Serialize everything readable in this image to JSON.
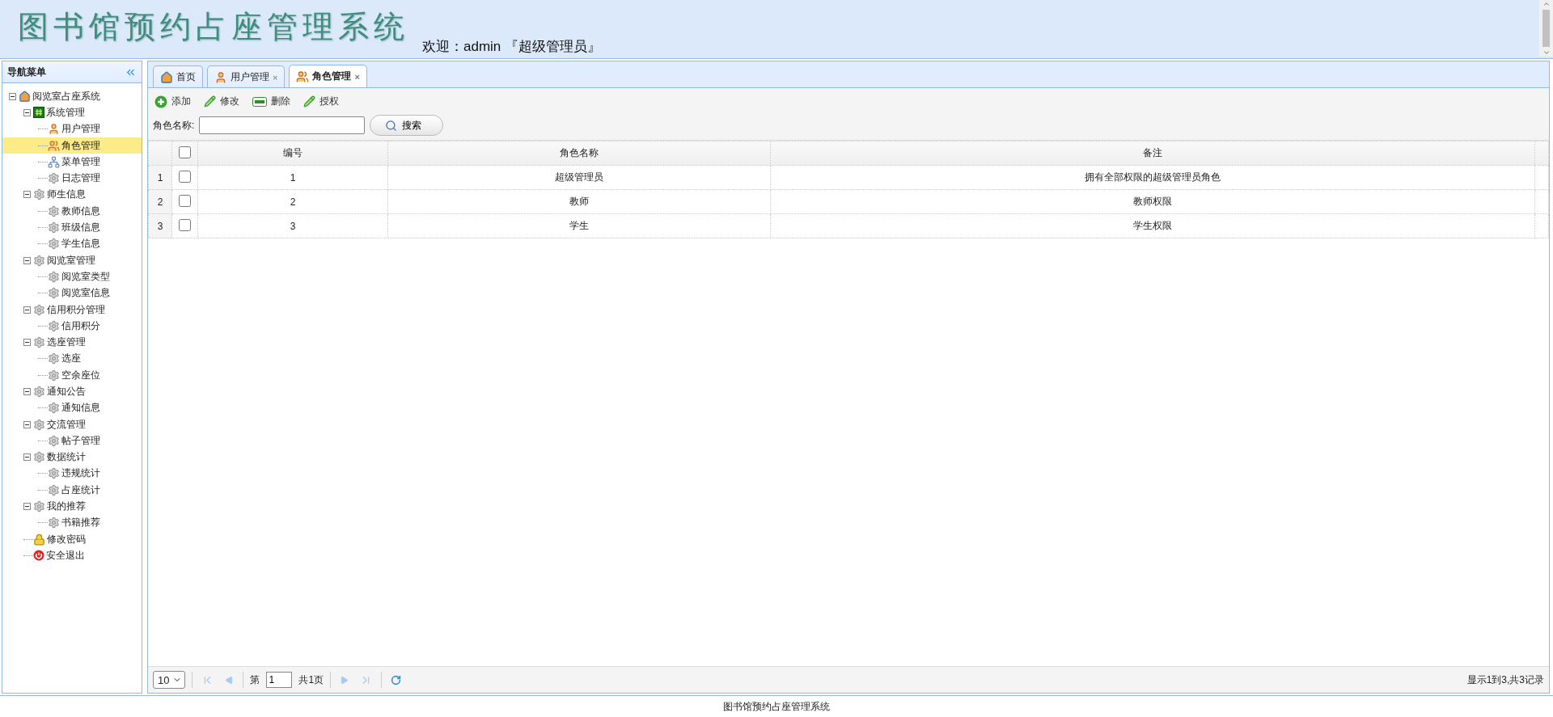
{
  "header": {
    "title": "图书馆预约占座管理系统",
    "welcome": "欢迎：admin 『超级管理员』"
  },
  "sidebar": {
    "title": "导航菜单",
    "tree": [
      {
        "label": "阅览室占座系统",
        "kind": "home",
        "expanded": true,
        "selected": false,
        "children": [
          {
            "label": "系统管理",
            "kind": "hash",
            "expanded": true,
            "selected": false,
            "children": [
              {
                "label": "用户管理",
                "kind": "user",
                "selected": false
              },
              {
                "label": "角色管理",
                "kind": "users",
                "selected": true
              },
              {
                "label": "菜单管理",
                "kind": "menu",
                "selected": false
              },
              {
                "label": "日志管理",
                "kind": "gear",
                "selected": false
              }
            ]
          },
          {
            "label": "师生信息",
            "kind": "gear",
            "expanded": true,
            "selected": false,
            "children": [
              {
                "label": "教师信息",
                "kind": "gear",
                "selected": false
              },
              {
                "label": "班级信息",
                "kind": "gear",
                "selected": false
              },
              {
                "label": "学生信息",
                "kind": "gear",
                "selected": false
              }
            ]
          },
          {
            "label": "阅览室管理",
            "kind": "gear",
            "expanded": true,
            "selected": false,
            "children": [
              {
                "label": "阅览室类型",
                "kind": "gear",
                "selected": false
              },
              {
                "label": "阅览室信息",
                "kind": "gear",
                "selected": false
              }
            ]
          },
          {
            "label": "信用积分管理",
            "kind": "gear",
            "expanded": true,
            "selected": false,
            "children": [
              {
                "label": "信用积分",
                "kind": "gear",
                "selected": false
              }
            ]
          },
          {
            "label": "选座管理",
            "kind": "gear",
            "expanded": true,
            "selected": false,
            "children": [
              {
                "label": "选座",
                "kind": "gear",
                "selected": false
              },
              {
                "label": "空余座位",
                "kind": "gear",
                "selected": false
              }
            ]
          },
          {
            "label": "通知公告",
            "kind": "gear",
            "expanded": true,
            "selected": false,
            "children": [
              {
                "label": "通知信息",
                "kind": "gear",
                "selected": false
              }
            ]
          },
          {
            "label": "交流管理",
            "kind": "gear",
            "expanded": true,
            "selected": false,
            "children": [
              {
                "label": "帖子管理",
                "kind": "gear",
                "selected": false
              }
            ]
          },
          {
            "label": "数据统计",
            "kind": "gear",
            "expanded": true,
            "selected": false,
            "children": [
              {
                "label": "违规统计",
                "kind": "gear",
                "selected": false
              },
              {
                "label": "占座统计",
                "kind": "gear",
                "selected": false
              }
            ]
          },
          {
            "label": "我的推荐",
            "kind": "gear",
            "expanded": true,
            "selected": false,
            "children": [
              {
                "label": "书籍推荐",
                "kind": "gear",
                "selected": false
              }
            ]
          },
          {
            "label": "修改密码",
            "kind": "lock",
            "selected": false
          },
          {
            "label": "安全退出",
            "kind": "exit",
            "selected": false
          }
        ]
      }
    ]
  },
  "tabs": [
    {
      "label": "首页",
      "kind": "home",
      "selected": false
    },
    {
      "label": "用户管理",
      "kind": "user",
      "close": "×",
      "selected": false
    },
    {
      "label": "角色管理",
      "kind": "users",
      "close": "×",
      "selected": true
    }
  ],
  "toolbar": [
    {
      "label": "添加",
      "kind": "add"
    },
    {
      "label": "修改",
      "kind": "edit"
    },
    {
      "label": "删除",
      "kind": "remove"
    },
    {
      "label": "授权",
      "kind": "edit"
    }
  ],
  "search": {
    "label": "角色名称:",
    "button": "搜索"
  },
  "table": {
    "header_checked": false,
    "columns": [
      "编号",
      "角色名称",
      "备注"
    ],
    "rows": [
      {
        "number": "1",
        "checked": false,
        "cells": [
          "1",
          "超级管理员",
          "拥有全部权限的超级管理员角色"
        ]
      },
      {
        "number": "2",
        "checked": false,
        "cells": [
          "2",
          "教师",
          "教师权限"
        ]
      },
      {
        "number": "3",
        "checked": false,
        "cells": [
          "3",
          "学生",
          "学生权限"
        ]
      }
    ]
  },
  "pagination": {
    "page_size": "10",
    "page_prefix": "第",
    "page": "1",
    "page_total": "共1页",
    "summary": "显示1到3,共3记录"
  },
  "footer": "图书馆预约占座管理系统"
}
